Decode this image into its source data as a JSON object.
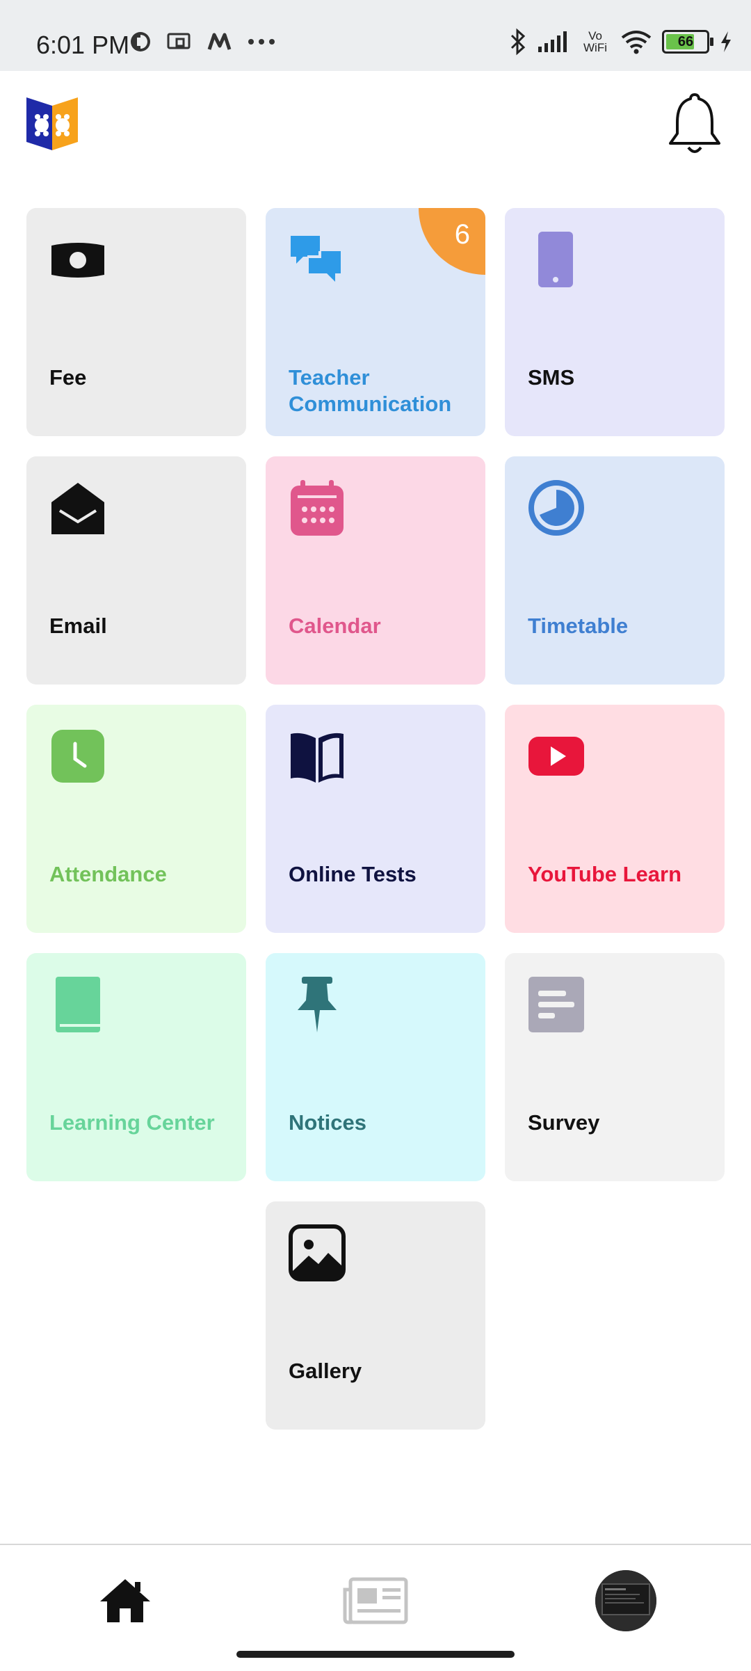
{
  "status_bar": {
    "time": "6:01 PM",
    "left_icons": [
      "app-status-icon",
      "screen-cast-icon",
      "m-app-icon",
      "more-dots-icon"
    ],
    "right_icons": [
      "bluetooth-icon",
      "signal-icon",
      "vowifi-icon",
      "wifi-icon",
      "battery-icon",
      "charging-icon"
    ],
    "vowifi_text": "Vo WiFi",
    "battery_level": "66"
  },
  "header": {
    "logo": "book-logo",
    "notification_icon": "bell-icon"
  },
  "tiles": [
    {
      "label": "Fee",
      "icon": "money-icon",
      "bg": "#ececec",
      "color": "#111111"
    },
    {
      "label": "Teacher Communication",
      "icon": "chat-bubbles-icon",
      "bg": "#dce7f8",
      "color": "#2f8fd8",
      "badge": "6"
    },
    {
      "label": "SMS",
      "icon": "phone-icon",
      "bg": "#e6e6fa",
      "color": "#111111"
    },
    {
      "label": "Email",
      "icon": "envelope-icon",
      "bg": "#ececec",
      "color": "#111111"
    },
    {
      "label": "Calendar",
      "icon": "calendar-icon",
      "bg": "#fcd8e6",
      "color": "#e0578c"
    },
    {
      "label": "Timetable",
      "icon": "clock-pie-icon",
      "bg": "#dce7f8",
      "color": "#3f7fd1"
    },
    {
      "label": "Attendance",
      "icon": "clock-square-icon",
      "bg": "#e8fce4",
      "color": "#72c25a"
    },
    {
      "label": "Online Tests",
      "icon": "open-book-icon",
      "bg": "#e6e7fa",
      "color": "#0f1240"
    },
    {
      "label": "YouTube Learn",
      "icon": "youtube-icon",
      "bg": "#ffdde3",
      "color": "#e8163b"
    },
    {
      "label": "Learning Center",
      "icon": "book-icon",
      "bg": "#dcfce8",
      "color": "#67d49a"
    },
    {
      "label": "Notices",
      "icon": "pushpin-icon",
      "bg": "#d6f9fc",
      "color": "#2f7479"
    },
    {
      "label": "Survey",
      "icon": "survey-icon",
      "bg": "#f2f2f2",
      "color": "#111111"
    },
    {
      "label": "Gallery",
      "icon": "image-icon",
      "bg": "#ececec",
      "color": "#111111"
    }
  ],
  "bottom_nav": [
    {
      "icon": "home-icon",
      "active": true
    },
    {
      "icon": "newspaper-icon",
      "active": false
    },
    {
      "icon": "profile-avatar",
      "active": false
    }
  ]
}
